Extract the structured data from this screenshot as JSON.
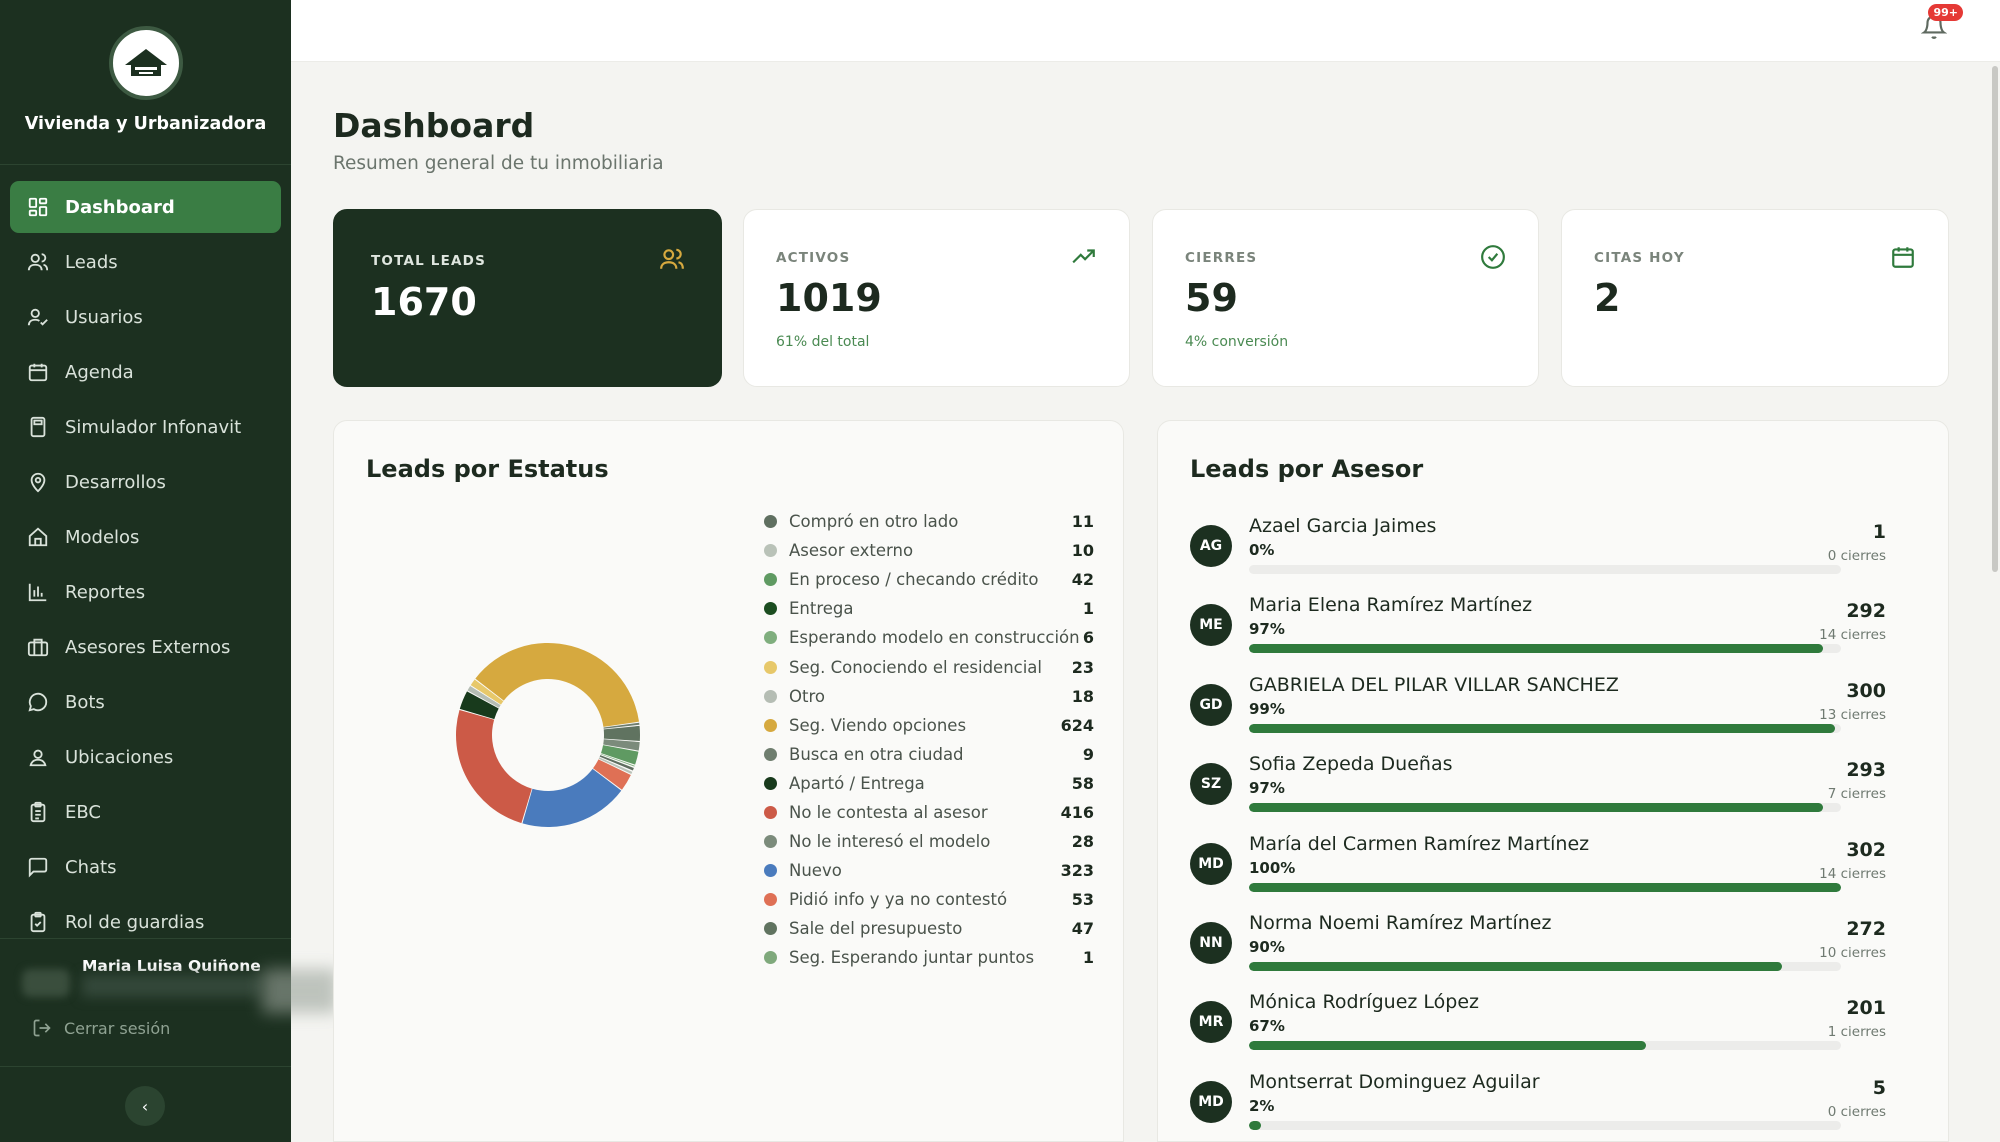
{
  "brand": {
    "name": "Vivienda y Urbanizadora"
  },
  "nav": [
    {
      "label": "Dashboard",
      "icon": "dashboard-icon",
      "active": true
    },
    {
      "label": "Leads",
      "icon": "users-icon"
    },
    {
      "label": "Usuarios",
      "icon": "user-check-icon"
    },
    {
      "label": "Agenda",
      "icon": "calendar-icon"
    },
    {
      "label": "Simulador Infonavit",
      "icon": "calculator-icon"
    },
    {
      "label": "Desarrollos",
      "icon": "map-pin-icon"
    },
    {
      "label": "Modelos",
      "icon": "home-icon"
    },
    {
      "label": "Reportes",
      "icon": "bar-chart-icon"
    },
    {
      "label": "Asesores Externos",
      "icon": "briefcase-icon"
    },
    {
      "label": "Bots",
      "icon": "message-circle-icon"
    },
    {
      "label": "Ubicaciones",
      "icon": "user-pin-icon"
    },
    {
      "label": "EBC",
      "icon": "clipboard-list-icon"
    },
    {
      "label": "Chats",
      "icon": "message-square-icon"
    },
    {
      "label": "Rol de guardias",
      "icon": "clipboard-check-icon"
    }
  ],
  "user": {
    "name": "Maria Luisa Quiñone"
  },
  "logout_label": "Cerrar sesión",
  "collapse_label": "‹",
  "notifications": {
    "badge": "99+"
  },
  "header": {
    "title": "Dashboard",
    "subtitle": "Resumen general de tu inmobiliaria"
  },
  "stats": [
    {
      "label": "TOTAL LEADS",
      "value": "1670",
      "note": "",
      "icon": "users-icon"
    },
    {
      "label": "ACTIVOS",
      "value": "1019",
      "note": "61% del total",
      "icon": "trending-up-icon"
    },
    {
      "label": "CIERRES",
      "value": "59",
      "note": "4% conversión",
      "icon": "check-circle-icon"
    },
    {
      "label": "CITAS HOY",
      "value": "2",
      "note": "",
      "icon": "calendar-icon"
    }
  ],
  "status_panel": {
    "title": "Leads por Estatus"
  },
  "chart_data": {
    "type": "pie",
    "title": "Leads por Estatus",
    "categories": [
      "Compró en otro lado",
      "Asesor externo",
      "En proceso / checando crédito",
      "Entrega",
      "Esperando modelo en construcción",
      "Seg. Conociendo el residencial",
      "Otro",
      "Seg. Viendo opciones",
      "Busca en otra ciudad",
      "Apartó / Entrega",
      "No le contesta al asesor",
      "No le interesó el modelo",
      "Nuevo",
      "Pidió info y ya no contestó",
      "Sale del presupuesto",
      "Seg. Esperando juntar puntos"
    ],
    "values": [
      11,
      10,
      42,
      1,
      6,
      23,
      18,
      624,
      9,
      58,
      416,
      28,
      323,
      53,
      47,
      1
    ],
    "colors": [
      "#5f6f60",
      "#b9c2b8",
      "#5f9a62",
      "#1b4d20",
      "#7fae7e",
      "#e7c86a",
      "#b5bdb4",
      "#d6a93f",
      "#6f7e6f",
      "#183a1c",
      "#cc5a47",
      "#7b8b7b",
      "#4a7bbd",
      "#df7055",
      "#607360",
      "#7fa97c"
    ],
    "legend": "right"
  },
  "advisor_panel": {
    "title": "Leads por Asesor"
  },
  "advisors": [
    {
      "initials": "AG",
      "name": "Azael Garcia Jaimes",
      "pct": "0%",
      "fill": 0,
      "count": "1",
      "closings": "0 cierres"
    },
    {
      "initials": "ME",
      "name": "Maria Elena Ramírez Martínez",
      "pct": "97%",
      "fill": 0.97,
      "count": "292",
      "closings": "14 cierres"
    },
    {
      "initials": "GD",
      "name": "GABRIELA DEL PILAR VILLAR SANCHEZ",
      "pct": "99%",
      "fill": 0.99,
      "count": "300",
      "closings": "13 cierres"
    },
    {
      "initials": "SZ",
      "name": "Sofia Zepeda Dueñas",
      "pct": "97%",
      "fill": 0.97,
      "count": "293",
      "closings": "7 cierres"
    },
    {
      "initials": "MD",
      "name": "María del Carmen Ramírez Martínez",
      "pct": "100%",
      "fill": 1.0,
      "count": "302",
      "closings": "14 cierres"
    },
    {
      "initials": "NN",
      "name": "Norma Noemi Ramírez Martínez",
      "pct": "90%",
      "fill": 0.9,
      "count": "272",
      "closings": "10 cierres"
    },
    {
      "initials": "MR",
      "name": "Mónica Rodríguez López",
      "pct": "67%",
      "fill": 0.67,
      "count": "201",
      "closings": "1 cierres"
    },
    {
      "initials": "MD",
      "name": "Montserrat Dominguez Aguilar",
      "pct": "2%",
      "fill": 0.02,
      "count": "5",
      "closings": "0 cierres"
    }
  ]
}
